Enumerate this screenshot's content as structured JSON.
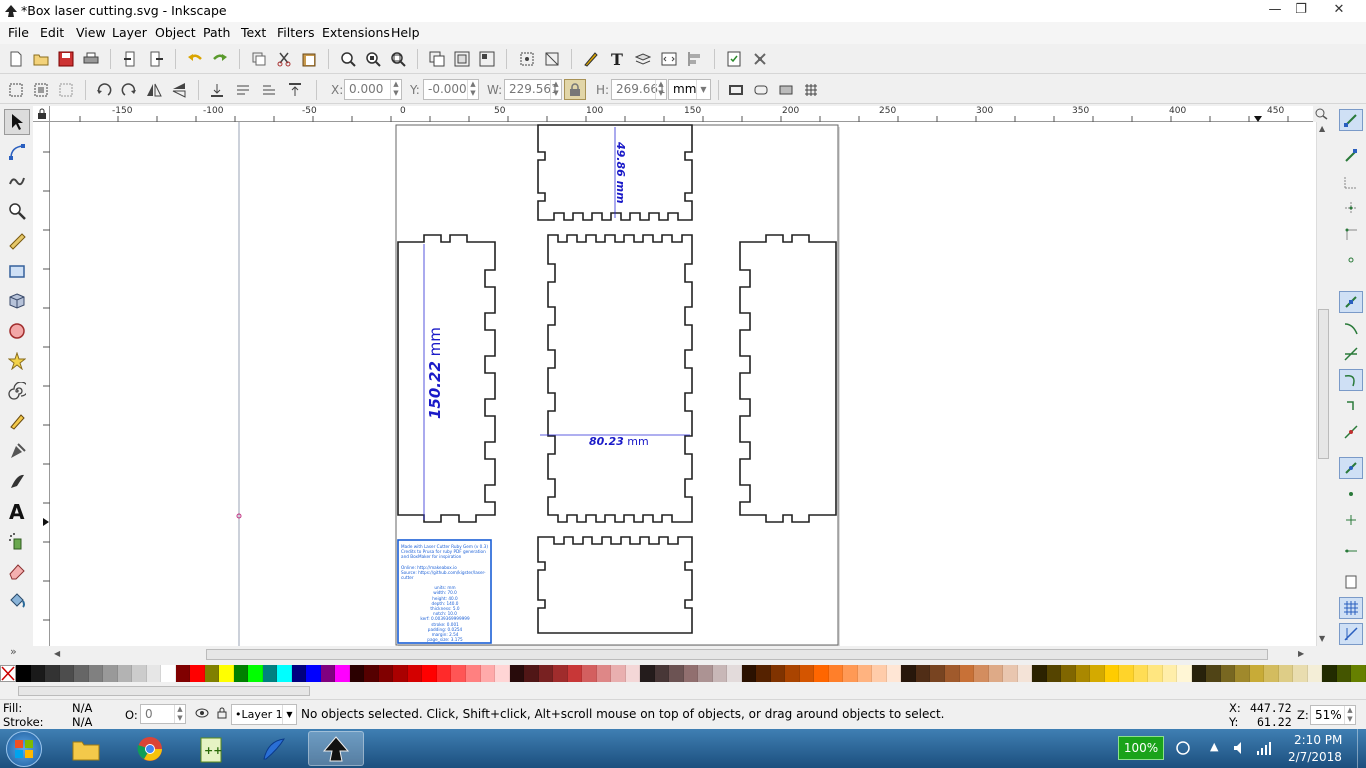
{
  "window": {
    "title": "*Box laser cutting.svg - Inkscape"
  },
  "menu": [
    "File",
    "Edit",
    "View",
    "Layer",
    "Object",
    "Path",
    "Text",
    "Filters",
    "Extensions",
    "Help"
  ],
  "toolbar": {
    "x_label": "X:",
    "x_value": "0.000",
    "y_label": "Y:",
    "y_value": "-0.000",
    "w_label": "W:",
    "w_value": "229.561",
    "h_label": "H:",
    "h_value": "269.661",
    "unit": "mm"
  },
  "ruler": {
    "labels": [
      "-150",
      "-100",
      "-50",
      "0",
      "50",
      "100",
      "150",
      "200",
      "250",
      "300",
      "350",
      "400",
      "450"
    ]
  },
  "canvas": {
    "dim_top": "49.86 mm",
    "dim_left_num": "150.22",
    "dim_left_unit": "mm",
    "dim_mid_num": "80.23",
    "dim_mid_unit": "mm",
    "info_lines": [
      "Made with Laser Cutter Ruby Gem (v 0.3)",
      "Credits to Prusa for ruby PDF generation",
      "and BoxMaker for inspiration",
      "",
      "Online: http://makeabox.io",
      "Source: https://github.com/kigster/laser-cutter",
      "",
      "units: mm",
      "width: 70.0",
      "height: 40.0",
      "depth: 140.0",
      "thickness: 5.0",
      "notch: 10.0",
      "kerf: 0.0039369999999",
      "stroke: 0.001",
      "padding: 0.0254",
      "margin: 2.54",
      "page_size: 3.175"
    ]
  },
  "status": {
    "fill_label": "Fill:",
    "fill_value": "N/A",
    "stroke_label": "Stroke:",
    "stroke_value": "N/A",
    "opacity_label": "O:",
    "opacity_value": "0",
    "layer": "•Layer 1",
    "message": "No objects selected. Click, Shift+click, Alt+scroll mouse on top of objects, or drag around objects to select.",
    "cursor_x_label": "X:",
    "cursor_x": "447.72",
    "cursor_y_label": "Y:",
    "cursor_y": "61.22",
    "zoom_label": "Z:",
    "zoom": "51%"
  },
  "taskbar": {
    "battery": "100%",
    "time": "2:10 PM",
    "date": "2/7/2018"
  },
  "colors": {
    "accent": "#1a1ac8",
    "selection_blue": "#1a5fd6"
  },
  "palette": [
    "#000000",
    "#1a1a1a",
    "#333333",
    "#4d4d4d",
    "#666666",
    "#808080",
    "#999999",
    "#b3b3b3",
    "#cccccc",
    "#e6e6e6",
    "#ffffff",
    "#800000",
    "#ff0000",
    "#808000",
    "#ffff00",
    "#008000",
    "#00ff00",
    "#008080",
    "#00ffff",
    "#000080",
    "#0000ff",
    "#800080",
    "#ff00ff",
    "#2b0000",
    "#550000",
    "#800000",
    "#aa0000",
    "#d40000",
    "#ff0000",
    "#ff2a2a",
    "#ff5555",
    "#ff8080",
    "#ffaaaa",
    "#ffd5d5",
    "#280b0b",
    "#501616",
    "#782121",
    "#a02c2c",
    "#c83737",
    "#d35f5f",
    "#de8787",
    "#e9afaf",
    "#f4d7d7",
    "#241c1c",
    "#483737",
    "#6c5353",
    "#916f6f",
    "#ac9393",
    "#c8b7b7",
    "#e3dbdb",
    "#2b1100",
    "#552200",
    "#803300",
    "#aa4400",
    "#d45500",
    "#ff6600",
    "#ff7f2a",
    "#ff9955",
    "#ffb380",
    "#ffccaa",
    "#ffe6d5",
    "#28170b",
    "#502d16",
    "#784421",
    "#a05a2c",
    "#c87137",
    "#d38d5f",
    "#deaa87",
    "#e9c6af",
    "#f4e3d7",
    "#2b2200",
    "#554400",
    "#806600",
    "#aa8800",
    "#d4aa00",
    "#ffcc00",
    "#ffd42a",
    "#ffdd55",
    "#ffe680",
    "#ffeeaa",
    "#fff6d5",
    "#28220b",
    "#504416",
    "#786721",
    "#a0892c",
    "#c8ab37",
    "#d3bc5f",
    "#decd87",
    "#e9ddaf",
    "#f4eed7",
    "#222b00",
    "#445500",
    "#668000"
  ]
}
